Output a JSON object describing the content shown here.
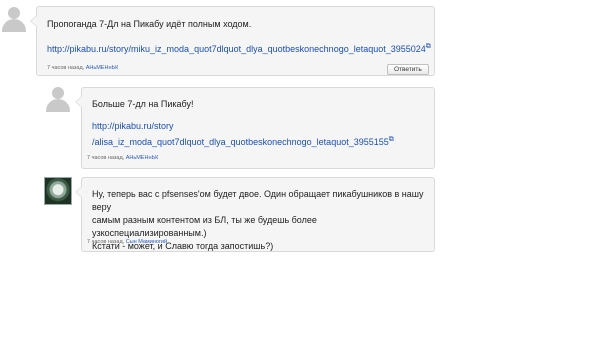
{
  "comments": [
    {
      "text": "Пропоганда 7-Дл на Пикабу идёт полным ходом.",
      "link": "http://pikabu.ru/story/miku_iz_moda_quot7dlquot_dlya_quotbeskonechnogo_letaquot_3955024",
      "time": "7 часов назад,",
      "author": "АНьМЕНнЬК",
      "reply_label": "Ответить",
      "external_icon": "external-link-icon"
    },
    {
      "text": "Больше 7-дл на Пикабу!",
      "link_line1": "http://pikabu.ru/story",
      "link_line2": "/alisa_iz_moda_quot7dlquot_dlya_quotbeskonechnogo_letaquot_3955155",
      "time": "7 часов назад,",
      "author": "АНьМЕНнЬК",
      "external_icon": "external-link-icon"
    },
    {
      "text_line1": "Ну, теперь вас с pfsenses'ом будет двое. Один обращает пикабушников в нашу веру",
      "text_line2": "самым разным контентом из БЛ, ты же будешь более узкоспециализированным.)",
      "text_line3": "Кстати - может, и Славю тогда запостишь?)",
      "time": "7 часов назад,",
      "author": "Сын Маминогий"
    }
  ]
}
